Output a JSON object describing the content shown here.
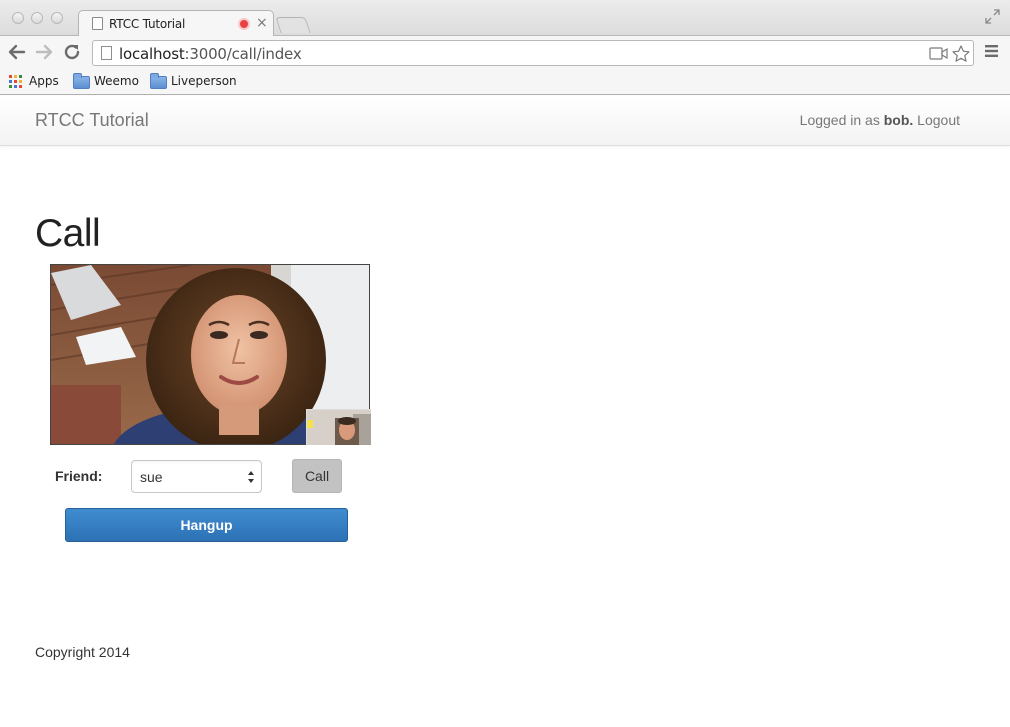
{
  "browser": {
    "tab_title": "RTCC Tutorial",
    "url_host": "localhost",
    "url_path": ":3000/call/index",
    "bookmarks": [
      {
        "label": "Apps",
        "icon": "apps-grid-icon"
      },
      {
        "label": "Weemo",
        "icon": "folder-icon"
      },
      {
        "label": "Liveperson",
        "icon": "folder-icon"
      }
    ]
  },
  "navbar": {
    "brand": "RTCC Tutorial",
    "logged_in_prefix": "Logged in as",
    "username": "bob.",
    "logout": "Logout"
  },
  "main": {
    "title": "Call",
    "friend_label": "Friend:",
    "friend_selected": "sue",
    "call_label": "Call",
    "hangup_label": "Hangup"
  },
  "footer": {
    "copyright": "Copyright 2014"
  },
  "colors": {
    "hangup_button": "#2f78bd",
    "call_button": "#c2c2c2",
    "recording_indicator": "#e94340"
  }
}
